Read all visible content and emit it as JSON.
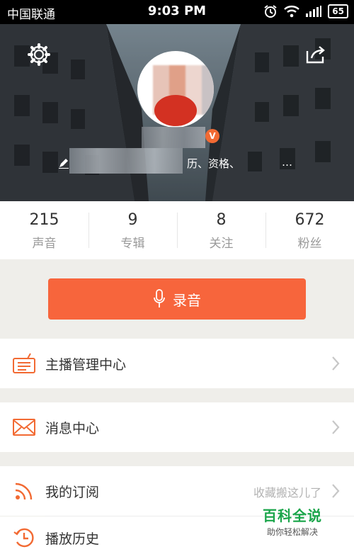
{
  "status_bar": {
    "carrier": "中国联通",
    "time": "9:03 PM",
    "battery": "65"
  },
  "profile": {
    "bio_visible": "历、资格、",
    "bio_tail": "…",
    "verified_badge": "V"
  },
  "stats": [
    {
      "value": "215",
      "label": "声音"
    },
    {
      "value": "9",
      "label": "专辑"
    },
    {
      "value": "8",
      "label": "关注"
    },
    {
      "value": "672",
      "label": "粉丝"
    }
  ],
  "record_button": {
    "label": "录音"
  },
  "menu": [
    {
      "label": "主播管理中心",
      "icon": "radio-icon"
    },
    {
      "label": "消息中心",
      "icon": "envelope-icon"
    },
    {
      "label": "我的订阅",
      "icon": "rss-icon",
      "hint": "收藏搬这儿了"
    },
    {
      "label": "播放历史",
      "icon": "clock-icon"
    }
  ],
  "watermark": {
    "title": "百科全说",
    "subtitle": "助你轻松解决"
  },
  "colors": {
    "accent": "#f7653c",
    "verified": "#f26a33",
    "watermark_green": "#1aa54a"
  }
}
